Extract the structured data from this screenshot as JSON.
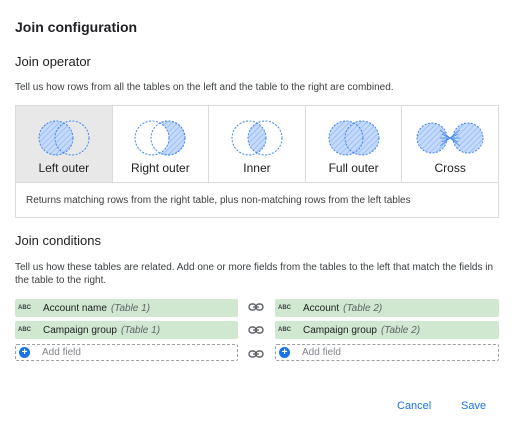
{
  "dialog": {
    "title": "Join configuration"
  },
  "operator": {
    "heading": "Join operator",
    "description": "Tell us how rows from all the tables on the left and the table to the right are combined.",
    "options": [
      {
        "label": "Left outer",
        "icon": "left-outer-join-icon",
        "selected": true
      },
      {
        "label": "Right outer",
        "icon": "right-outer-join-icon",
        "selected": false
      },
      {
        "label": "Inner",
        "icon": "inner-join-icon",
        "selected": false
      },
      {
        "label": "Full outer",
        "icon": "full-outer-join-icon",
        "selected": false
      },
      {
        "label": "Cross",
        "icon": "cross-join-icon",
        "selected": false
      }
    ],
    "selected_description": "Returns matching rows from the right table, plus non-matching rows from the left tables"
  },
  "conditions": {
    "heading": "Join conditions",
    "description": "Tell us how these tables are related. Add one or more fields from the tables to the left that match the fields in the table to the right.",
    "rows": [
      {
        "left": {
          "type": "ABC",
          "name": "Account name",
          "table": "(Table 1)"
        },
        "right": {
          "type": "ABC",
          "name": "Account",
          "table": "(Table 2)"
        }
      },
      {
        "left": {
          "type": "ABC",
          "name": "Campaign group",
          "table": "(Table 1)"
        },
        "right": {
          "type": "ABC",
          "name": "Campaign group",
          "table": "(Table 2)"
        }
      }
    ],
    "add_field_label": "Add field",
    "link_icon": "link-icon"
  },
  "footer": {
    "cancel_label": "Cancel",
    "save_label": "Save"
  },
  "colors": {
    "accent": "#1a73e8",
    "chip": "#cfe8cf",
    "venn_fill": "#aecbfa",
    "venn_stroke": "#4285f4"
  }
}
